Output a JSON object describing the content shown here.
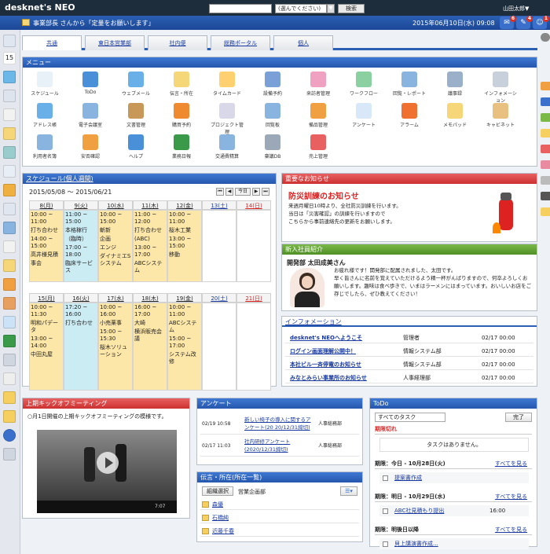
{
  "app": {
    "logo": "desknet's NEO",
    "user": "山田太郎▼"
  },
  "search": {
    "placeholder": "",
    "scope": "(選んでください)",
    "dd": "▼",
    "button": "検索"
  },
  "msgbar": {
    "text": "事業部長 さんから「定量をお願いします」",
    "date": "2015年06月10日(水) 09:08"
  },
  "badges": [
    {
      "count": "6"
    },
    {
      "count": "4"
    },
    {
      "count": "1"
    }
  ],
  "tabs": [
    "共通",
    "東日本営業部",
    "社内便",
    "総務ポータル",
    "個人"
  ],
  "menu": {
    "title": "メニュー",
    "items": [
      "スケジュール",
      "ToDo",
      "ウェブメール",
      "伝言・所在",
      "タイムカード",
      "設備予約",
      "来訪者管理",
      "ワークフロー",
      "回覧・レポート",
      "議事録",
      "インフォメーション",
      "アドレス帳",
      "電子会議室",
      "文書管理",
      "購買予約",
      "プロジェクト管理",
      "回覧板",
      "備品管理",
      "アンケート",
      "アラーム",
      "メモパッド",
      "キャビネット",
      "利用者名簿",
      "安否確認",
      "ヘルプ",
      "業務日報",
      "交通費精算",
      "稟議DB",
      "売上管理"
    ]
  },
  "schedule": {
    "title": "スケジュール(個人週間)",
    "range": "2015/05/08 ～ 2015/06/21",
    "nav": [
      "⏮",
      "◀",
      "今日",
      "▶",
      "⏭"
    ],
    "week1": [
      "8(月)",
      "9(火)",
      "10(水)",
      "11(木)",
      "12(金)",
      "13(土)",
      "14(日)"
    ],
    "week2": [
      "15(月)",
      "16(火)",
      "17(水)",
      "18(木)",
      "19(金)",
      "20(土)",
      "21(日)"
    ],
    "w1ev": [
      [
        "10:00 ~ 11:00",
        "打ち合わせ",
        "14:00 ~ 15:00",
        "高井様見積",
        "事会"
      ],
      [
        "11:00 ~ 15:00",
        "本格稼行",
        "（臨時）",
        "17:00 ~ 18:00",
        "臨床サービス"
      ],
      [
        "10:00 ~ 15:00",
        "斬新",
        "企画",
        "エンジ",
        "ダイナミエSシステム"
      ],
      [
        "11:00 ~ 12:00",
        "打ち合わせ",
        "(ABC)",
        "13:00 ~ 17:00",
        "ABCシステム"
      ],
      [
        "10:00 ~ 11:00",
        "桜木工業",
        "13:00 ~ 15:00",
        "移動"
      ],
      [],
      []
    ],
    "w2ev": [
      [
        "10:00 ~ 11:30",
        "明和パデータ",
        "13:00 ~ 14:00",
        "中田丸屋"
      ],
      [
        "17:20 ~ 16:00",
        "打ち合わせ"
      ],
      [
        "10:00 ~ 16:00",
        "小売薬事",
        "15:00 ~ 15:30",
        "桜木ソリューション"
      ],
      [
        "16:00 ~ 17:00",
        "大崎",
        "横浜販売会議"
      ],
      [
        "10:00 ~ 11:00",
        "ABCシステム",
        "15:00 ~ 17:00",
        "システム改修"
      ],
      [],
      []
    ]
  },
  "notice": {
    "title": "重要なお知らせ",
    "headline": "防災訓練のお知らせ",
    "body": [
      "来週月曜日10時より、全社防災訓練を行います。",
      "当日は「災害確認」の訓練を行いますので",
      "こちらから事前連絡先の更新をお願いします。"
    ],
    "link": "こちら"
  },
  "newcomer": {
    "title": "新入社員紹介",
    "heading": "開発部 太田成美さん",
    "body": [
      "お疲れ様です！開発部に配属されました、太田です。",
      "早く皆さんに名前を覚えていただけるよう精一杯がんばりますので、何卒よろしくお願いします。趣味は食べ歩きで、いまはラーメンにはまっています。おいしいお店をご存じでしたら、ぜひ教えてください！"
    ]
  },
  "info": {
    "title": "インフォメーション",
    "rows": [
      [
        "desknet's NEOへようこそ",
        "管理者",
        "02/17 00:00"
      ],
      [
        "ログイン画面理解公開中！",
        "情報システム部",
        "02/17 00:00"
      ],
      [
        "本社ビル一斉停電のお知らせ",
        "情報システム部",
        "02/17 00:00"
      ],
      [
        "みなとみらい事業所のお知らせ",
        "人事経理部",
        "02/17 00:00"
      ]
    ]
  },
  "kickoff": {
    "title": "上期キックオフミーティング",
    "text": "○月1日開催の上期キックオフミーティングの模様です。",
    "time": "7:07"
  },
  "survey": {
    "title": "アンケート",
    "rows": [
      [
        "02/19 10:58",
        "新しい椅子の導入に関するアンケート(20 20/12/31締切)",
        "人事総務部"
      ],
      [
        "02/17 11:03",
        "社内研修アンケート(2020/12/31締切)",
        "人事総務部"
      ]
    ]
  },
  "location": {
    "title": "伝言・所在(所在一覧)",
    "group_btn": "組織選択",
    "group": "営業企画部",
    "people": [
      "森優",
      "石橋純",
      "近藤千春"
    ]
  },
  "todo": {
    "title": "ToDo",
    "select": "すべてのタスク",
    "done_btn": "完了",
    "sections": [
      {
        "label": "期限切れ",
        "empty": "タスクはありません。"
      },
      {
        "label": "期限：今日 - 10月28日(火)",
        "more": "すべてを見る",
        "item": "提案書作成"
      },
      {
        "label": "期限：明日 - 10月29日(水)",
        "more": "すべてを見る",
        "item": "ABC社見積もり提出",
        "time": "16:00"
      },
      {
        "label": "期限：明後日以降",
        "more": "すべてを見る",
        "item": "貝上講演書作成..."
      }
    ]
  },
  "colors": {
    "brand": "#2b5fb3",
    "alert": "#cc3030",
    "green": "#4f8f25"
  }
}
